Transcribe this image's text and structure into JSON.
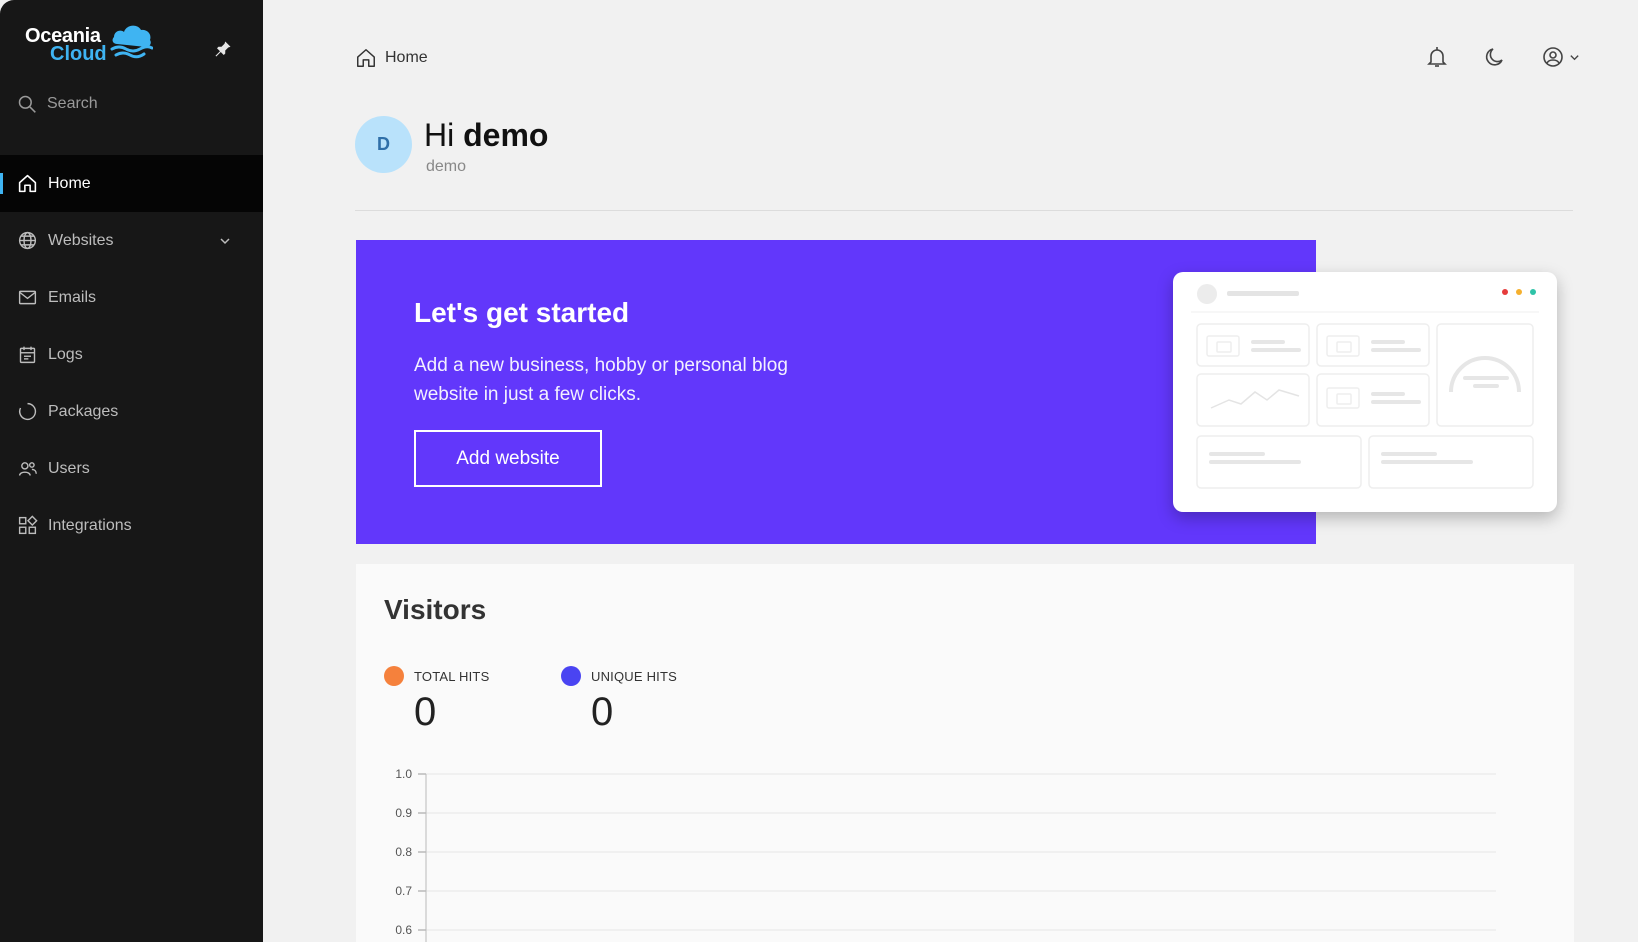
{
  "brand": {
    "line1": "Oceania",
    "line2": "Cloud",
    "accent": "#3fb4f2"
  },
  "sidebar": {
    "search_placeholder": "Search",
    "items": [
      {
        "label": "Home",
        "icon": "home-icon",
        "active": true
      },
      {
        "label": "Websites",
        "icon": "globe-icon",
        "has_submenu": true
      },
      {
        "label": "Emails",
        "icon": "mail-icon"
      },
      {
        "label": "Logs",
        "icon": "calendar-icon"
      },
      {
        "label": "Packages",
        "icon": "circle-icon"
      },
      {
        "label": "Users",
        "icon": "users-icon"
      },
      {
        "label": "Integrations",
        "icon": "grid-icon"
      }
    ]
  },
  "header": {
    "breadcrumb": "Home",
    "icons": [
      "bell-icon",
      "moon-icon",
      "user-circle-icon"
    ]
  },
  "greeting": {
    "avatar_letter": "D",
    "hi": "Hi",
    "name": "demo",
    "subtitle": "demo"
  },
  "banner": {
    "title": "Let's get started",
    "text": "Add a new business, hobby or personal blog website in just a few clicks.",
    "button": "Add website",
    "color": "#6237fb"
  },
  "visitors": {
    "title": "Visitors",
    "stats": [
      {
        "label": "TOTAL HITS",
        "value": "0",
        "color": "#f5813c"
      },
      {
        "label": "UNIQUE HITS",
        "value": "0",
        "color": "#4a44f2"
      }
    ]
  },
  "chart_data": {
    "type": "line",
    "series": [],
    "ylim": [
      0.6,
      1.0
    ],
    "yticks": [
      "1.0",
      "0.9",
      "0.8",
      "0.7",
      "0.6"
    ],
    "grid": true
  }
}
